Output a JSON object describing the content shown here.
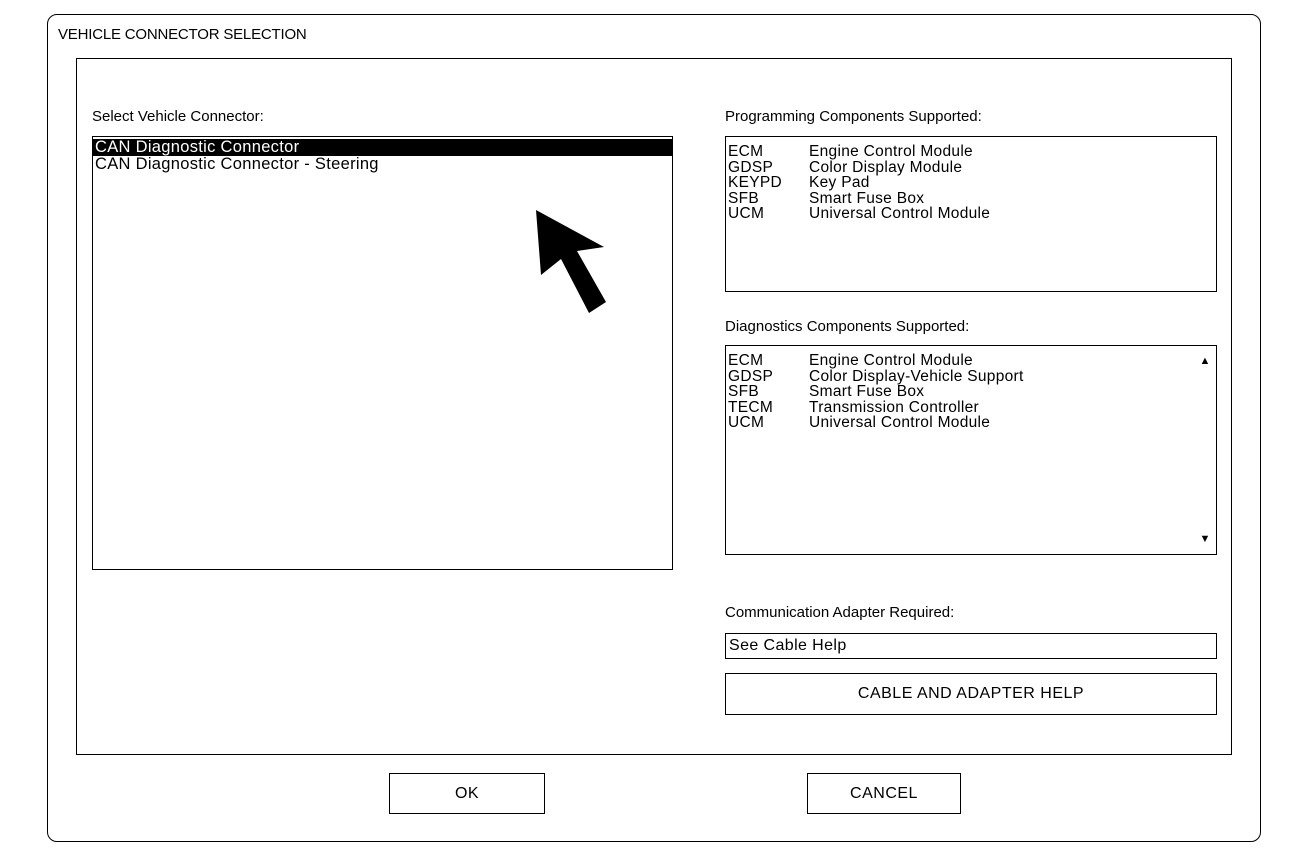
{
  "dialog": {
    "title": "VEHICLE CONNECTOR SELECTION"
  },
  "connector": {
    "label": "Select Vehicle Connector:",
    "items": [
      {
        "label": "CAN Diagnostic Connector",
        "selected": true
      },
      {
        "label": "CAN Diagnostic Connector - Steering",
        "selected": false
      }
    ]
  },
  "programming": {
    "label": "Programming Components Supported:",
    "rows": [
      {
        "code": "ECM",
        "name": "Engine Control Module"
      },
      {
        "code": "GDSP",
        "name": "Color Display Module"
      },
      {
        "code": "KEYPD",
        "name": "Key Pad"
      },
      {
        "code": "SFB",
        "name": "Smart Fuse Box"
      },
      {
        "code": "UCM",
        "name": "Universal Control Module"
      }
    ]
  },
  "diagnostics": {
    "label": "Diagnostics Components Supported:",
    "rows": [
      {
        "code": "ECM",
        "name": "Engine Control Module"
      },
      {
        "code": "GDSP",
        "name": "Color Display-Vehicle Support"
      },
      {
        "code": "SFB",
        "name": "Smart Fuse Box"
      },
      {
        "code": "TECM",
        "name": "Transmission Controller"
      },
      {
        "code": "UCM",
        "name": "Universal Control Module"
      }
    ],
    "scroll_up_icon": "triangle-up",
    "scroll_down_icon": "triangle-down"
  },
  "adapter": {
    "label": "Communication Adapter Required:",
    "value": "See Cable Help",
    "help_button_label": "CABLE AND ADAPTER HELP"
  },
  "buttons": {
    "ok_label": "OK",
    "cancel_label": "CANCEL"
  },
  "colors": {
    "selection_bg": "#000000",
    "selection_fg": "#ffffff"
  }
}
